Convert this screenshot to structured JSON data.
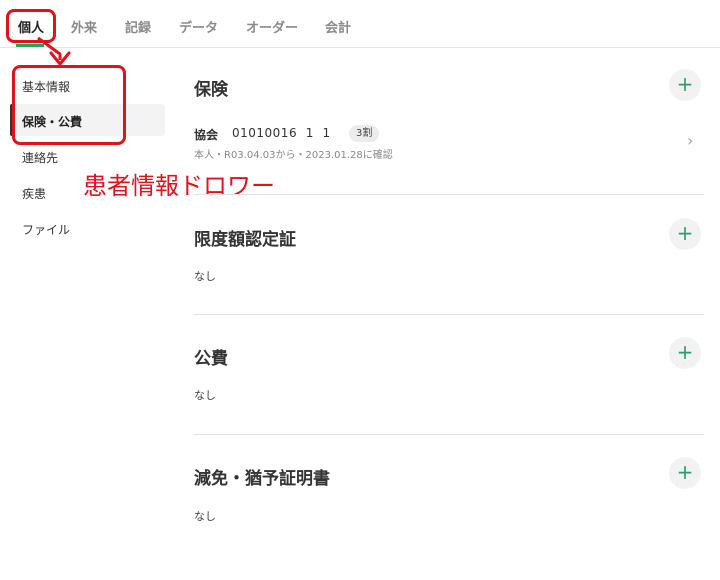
{
  "tabs": [
    {
      "label": "個人",
      "active": true
    },
    {
      "label": "外来"
    },
    {
      "label": "記録"
    },
    {
      "label": "データ"
    },
    {
      "label": "オーダー"
    },
    {
      "label": "会計"
    }
  ],
  "sidebar": {
    "items": [
      {
        "label": "基本情報"
      },
      {
        "label": "保険・公費",
        "selected": true
      },
      {
        "label": "連絡先"
      },
      {
        "label": "疾患"
      },
      {
        "label": "ファイル"
      }
    ]
  },
  "annotation": {
    "label": "患者情報ドロワー",
    "color": "#e0121b"
  },
  "sections": {
    "insurance": {
      "title": "保険",
      "add": "+",
      "entry": {
        "name": "協会",
        "number": "01010016  1  1",
        "badge": "3割",
        "detail": "本人・R03.04.03から・2023.01.28に確認",
        "chevron": "›"
      }
    },
    "limit": {
      "title": "限度額認定証",
      "add": "+",
      "empty": "なし"
    },
    "public": {
      "title": "公費",
      "add": "+",
      "empty": "なし"
    },
    "reduction": {
      "title": "減免・猶予証明書",
      "add": "+",
      "empty": "なし"
    }
  },
  "colors": {
    "accent": "#2a9d6a",
    "annotation": "#e0121b"
  }
}
